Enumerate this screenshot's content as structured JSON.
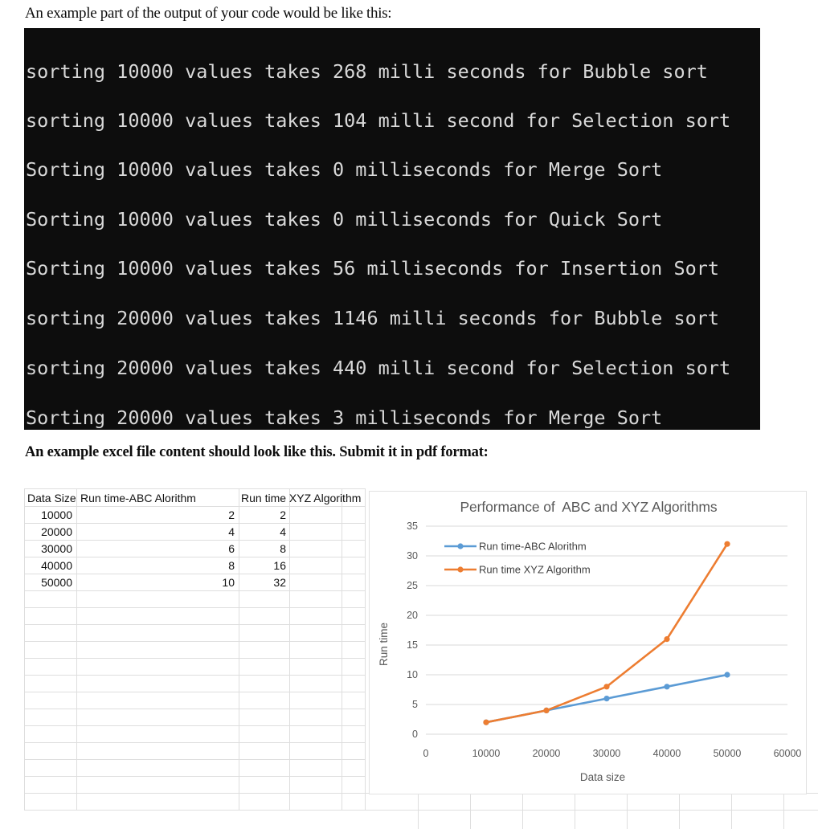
{
  "intro": {
    "text": "An example part of the output of your code would be like this:"
  },
  "console": {
    "background_color": "#0d0d0d",
    "text_color": "#d8d8d8",
    "lines": [
      "sorting 10000 values takes 268 milli seconds for Bubble sort",
      "sorting 10000 values takes 104 milli second for Selection sort",
      "Sorting 10000 values takes 0 milliseconds for Merge Sort",
      "Sorting 10000 values takes 0 milliseconds for Quick Sort",
      "Sorting 10000 values takes 56 milliseconds for Insertion Sort",
      "sorting 20000 values takes 1146 milli seconds for Bubble sort",
      "sorting 20000 values takes 440 milli second for Selection sort",
      "Sorting 20000 values takes 3 milliseconds for Merge Sort"
    ]
  },
  "excel_heading": {
    "text": "An example excel file content should look like this. Submit it in pdf format:"
  },
  "spreadsheet": {
    "headers": [
      "Data Size",
      "Run time-ABC Alorithm",
      "Run time XYZ Algorithm"
    ],
    "rows": [
      {
        "data_size": "10000",
        "abc": "2",
        "xyz": "2"
      },
      {
        "data_size": "20000",
        "abc": "4",
        "xyz": "4"
      },
      {
        "data_size": "30000",
        "abc": "6",
        "xyz": "8"
      },
      {
        "data_size": "40000",
        "abc": "8",
        "xyz": "16"
      },
      {
        "data_size": "50000",
        "abc": "10",
        "xyz": "32"
      }
    ]
  },
  "chart_data": {
    "type": "line",
    "title": "Performance of  ABC and XYZ Algorithms",
    "xlabel": "Data size",
    "ylabel": "Run time",
    "x": [
      10000,
      20000,
      30000,
      40000,
      50000
    ],
    "xticks": [
      "0",
      "10000",
      "20000",
      "30000",
      "40000",
      "50000",
      "60000"
    ],
    "xtick_values": [
      0,
      10000,
      20000,
      30000,
      40000,
      50000,
      60000
    ],
    "yticks": [
      "0",
      "5",
      "10",
      "15",
      "20",
      "25",
      "30",
      "35"
    ],
    "ytick_values": [
      0,
      5,
      10,
      15,
      20,
      25,
      30,
      35
    ],
    "xlim": [
      0,
      60000
    ],
    "ylim": [
      0,
      35
    ],
    "grid": "horizontal",
    "legend_position": "inside-top-left",
    "series": [
      {
        "name": "Run time-ABC Alorithm",
        "values": [
          2,
          4,
          6,
          8,
          10
        ],
        "color": "#5B9BD5"
      },
      {
        "name": "Run time XYZ Algorithm",
        "values": [
          2,
          4,
          8,
          16,
          32
        ],
        "color": "#ED7D31"
      }
    ]
  }
}
